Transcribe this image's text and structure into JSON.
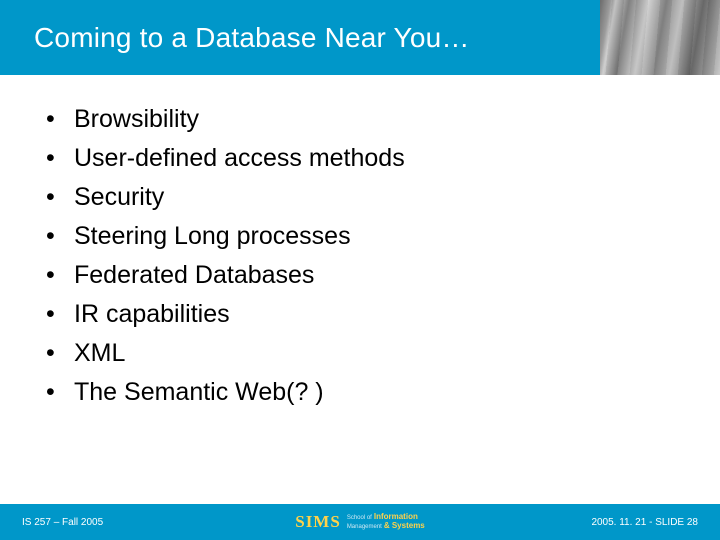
{
  "title": "Coming to a Database Near You…",
  "bullets": [
    "Browsibility",
    "User-defined access methods",
    "Security",
    "Steering Long processes",
    "Federated Databases",
    "IR capabilities",
    "XML",
    "The Semantic Web(? )"
  ],
  "footer": {
    "left": "IS 257 – Fall 2005",
    "right": "2005. 11. 21 - SLIDE 28",
    "logo": {
      "main": "SIMS",
      "line1_small": "School of",
      "line1_accent": "Information",
      "line2_small": "Management",
      "line2_accent": "& Systems"
    }
  }
}
